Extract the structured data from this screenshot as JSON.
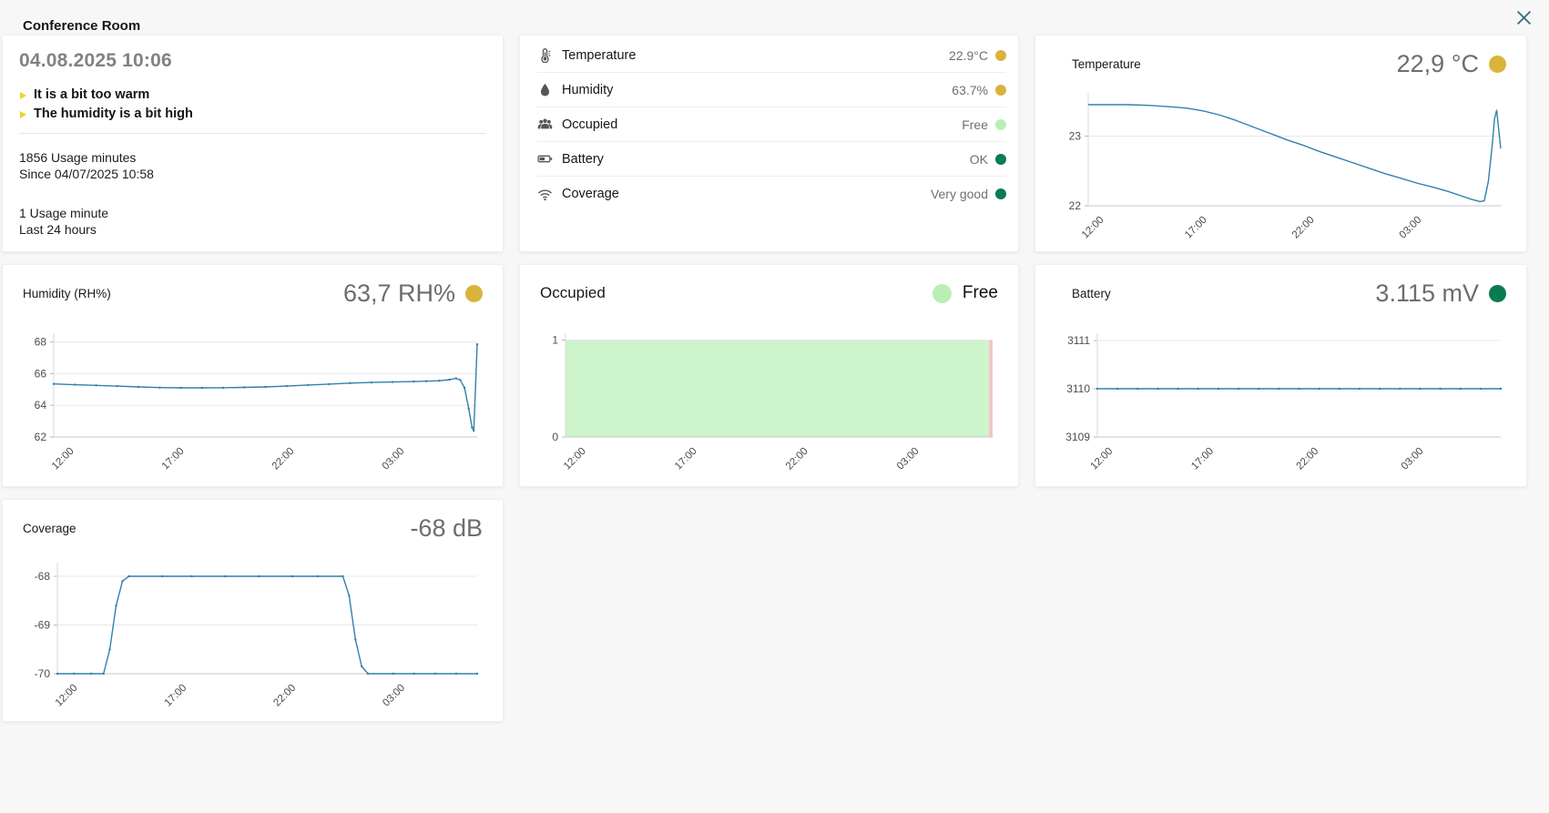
{
  "page": {
    "title": "Conference Room",
    "close_icon": "x"
  },
  "info": {
    "timestamp": "04.08.2025 10:06",
    "warnings": [
      "It is a bit too warm",
      "The humidity is a bit high"
    ],
    "usage_total_value": "1856 Usage minutes",
    "usage_total_caption": "Since 04/07/2025 10:58",
    "usage_recent_value": "1 Usage minute",
    "usage_recent_caption": "Last 24 hours"
  },
  "sensors": {
    "rows": [
      {
        "icon": "thermometer-icon",
        "label": "Temperature",
        "value": "22.9°C",
        "dot_color": "#d9b43b"
      },
      {
        "icon": "droplet-icon",
        "label": "Humidity",
        "value": "63.7%",
        "dot_color": "#d9b43b"
      },
      {
        "icon": "occupancy-icon",
        "label": "Occupied",
        "value": "Free",
        "dot_color": "#b9efb4"
      },
      {
        "icon": "battery-icon",
        "label": "Battery",
        "value": "OK",
        "dot_color": "#0b7b50"
      },
      {
        "icon": "wifi-icon",
        "label": "Coverage",
        "value": "Very good",
        "dot_color": "#0b7b50"
      }
    ]
  },
  "chart_data": [
    {
      "id": "temperature",
      "type": "line",
      "title": "Temperature",
      "value": "22,9 °C",
      "dot_color": "#d9b43b",
      "line_color": "#3380ab",
      "markers": false,
      "ymin": 22,
      "ymax": 23.62,
      "yticks": [
        22,
        23
      ],
      "xticks": [
        "12:00",
        "17:00",
        "22:00",
        "03:00"
      ],
      "xtick_frac": [
        0.03,
        0.28,
        0.54,
        0.8
      ],
      "points": [
        [
          0,
          23.45
        ],
        [
          0.05,
          23.45
        ],
        [
          0.1,
          23.45
        ],
        [
          0.15,
          23.44
        ],
        [
          0.2,
          23.42
        ],
        [
          0.24,
          23.4
        ],
        [
          0.28,
          23.36
        ],
        [
          0.32,
          23.3
        ],
        [
          0.36,
          23.22
        ],
        [
          0.4,
          23.13
        ],
        [
          0.44,
          23.04
        ],
        [
          0.48,
          22.95
        ],
        [
          0.52,
          22.87
        ],
        [
          0.56,
          22.78
        ],
        [
          0.6,
          22.7
        ],
        [
          0.64,
          22.62
        ],
        [
          0.68,
          22.54
        ],
        [
          0.72,
          22.46
        ],
        [
          0.76,
          22.39
        ],
        [
          0.8,
          22.32
        ],
        [
          0.84,
          22.26
        ],
        [
          0.87,
          22.21
        ],
        [
          0.9,
          22.15
        ],
        [
          0.93,
          22.09
        ],
        [
          0.95,
          22.06
        ],
        [
          0.96,
          22.07
        ],
        [
          0.97,
          22.35
        ],
        [
          0.98,
          22.9
        ],
        [
          0.985,
          23.25
        ],
        [
          0.99,
          23.37
        ],
        [
          1,
          22.82
        ]
      ]
    },
    {
      "id": "humidity",
      "type": "line",
      "title": "Humidity (RH%)",
      "value": "63,7 RH%",
      "dot_color": "#d9b43b",
      "line_color": "#3380ab",
      "markers": true,
      "ymin": 62,
      "ymax": 68.55,
      "yticks": [
        62,
        64,
        66,
        68
      ],
      "xticks": [
        "12:00",
        "17:00",
        "22:00",
        "03:00"
      ],
      "xtick_frac": [
        0.04,
        0.3,
        0.56,
        0.82
      ],
      "points": [
        [
          0,
          65.35
        ],
        [
          0.05,
          65.3
        ],
        [
          0.1,
          65.26
        ],
        [
          0.15,
          65.21
        ],
        [
          0.2,
          65.16
        ],
        [
          0.25,
          65.12
        ],
        [
          0.3,
          65.1
        ],
        [
          0.35,
          65.1
        ],
        [
          0.4,
          65.11
        ],
        [
          0.45,
          65.13
        ],
        [
          0.5,
          65.16
        ],
        [
          0.55,
          65.21
        ],
        [
          0.6,
          65.28
        ],
        [
          0.65,
          65.34
        ],
        [
          0.7,
          65.4
        ],
        [
          0.75,
          65.44
        ],
        [
          0.8,
          65.47
        ],
        [
          0.85,
          65.5
        ],
        [
          0.88,
          65.52
        ],
        [
          0.91,
          65.55
        ],
        [
          0.935,
          65.62
        ],
        [
          0.95,
          65.7
        ],
        [
          0.96,
          65.6
        ],
        [
          0.97,
          65.1
        ],
        [
          0.98,
          63.8
        ],
        [
          0.988,
          62.6
        ],
        [
          0.992,
          62.4
        ],
        [
          1,
          67.85
        ]
      ]
    },
    {
      "id": "occupied",
      "type": "area",
      "title": "Occupied",
      "value": "Free",
      "dot_color": "#b9efb4",
      "ymin": 0,
      "ymax": 1.07,
      "yticks": [
        0,
        1
      ],
      "xticks": [
        "12:00",
        "17:00",
        "22:00",
        "03:00"
      ],
      "xtick_frac": [
        0.04,
        0.3,
        0.56,
        0.82
      ],
      "segments": [
        {
          "from": 0,
          "to": 0.992,
          "value": 1,
          "label": "Free",
          "color": "#cdf4ca"
        },
        {
          "from": 0.992,
          "to": 1,
          "value": 1,
          "label": "Occupied",
          "color": "#f6c2c9"
        }
      ]
    },
    {
      "id": "battery",
      "type": "line",
      "title": "Battery",
      "value": "3.115 mV",
      "dot_color": "#0b7b50",
      "line_color": "#3380ab",
      "markers": true,
      "ymin": 3109,
      "ymax": 3111.15,
      "yticks": [
        3109,
        3110,
        3111
      ],
      "xticks": [
        "12:00",
        "17:00",
        "22:00",
        "03:00"
      ],
      "xtick_frac": [
        0.03,
        0.28,
        0.54,
        0.8
      ],
      "points": [
        [
          0,
          3110
        ],
        [
          0.05,
          3110
        ],
        [
          0.1,
          3110
        ],
        [
          0.15,
          3110
        ],
        [
          0.2,
          3110
        ],
        [
          0.25,
          3110
        ],
        [
          0.3,
          3110
        ],
        [
          0.35,
          3110
        ],
        [
          0.4,
          3110
        ],
        [
          0.45,
          3110
        ],
        [
          0.5,
          3110
        ],
        [
          0.55,
          3110
        ],
        [
          0.6,
          3110
        ],
        [
          0.65,
          3110
        ],
        [
          0.7,
          3110
        ],
        [
          0.75,
          3110
        ],
        [
          0.8,
          3110
        ],
        [
          0.85,
          3110
        ],
        [
          0.9,
          3110
        ],
        [
          0.95,
          3110
        ],
        [
          1,
          3110
        ]
      ]
    },
    {
      "id": "coverage",
      "type": "line",
      "title": "Coverage",
      "value": "-68 dB",
      "dot_color": null,
      "line_color": "#3380ab",
      "markers": true,
      "ymin": -70,
      "ymax": -67.72,
      "yticks": [
        -70,
        -69,
        -68
      ],
      "xticks": [
        "12:00",
        "17:00",
        "22:00",
        "03:00"
      ],
      "xtick_frac": [
        0.04,
        0.3,
        0.56,
        0.82
      ],
      "points": [
        [
          0,
          -70
        ],
        [
          0.04,
          -70
        ],
        [
          0.08,
          -70
        ],
        [
          0.11,
          -70
        ],
        [
          0.125,
          -69.5
        ],
        [
          0.14,
          -68.6
        ],
        [
          0.155,
          -68.1
        ],
        [
          0.17,
          -68
        ],
        [
          0.25,
          -68
        ],
        [
          0.32,
          -68
        ],
        [
          0.4,
          -68
        ],
        [
          0.48,
          -68
        ],
        [
          0.56,
          -68
        ],
        [
          0.62,
          -68
        ],
        [
          0.68,
          -68
        ],
        [
          0.695,
          -68.4
        ],
        [
          0.71,
          -69.3
        ],
        [
          0.725,
          -69.85
        ],
        [
          0.74,
          -70
        ],
        [
          0.8,
          -70
        ],
        [
          0.85,
          -70
        ],
        [
          0.9,
          -70
        ],
        [
          0.95,
          -70
        ],
        [
          1,
          -70
        ]
      ]
    }
  ]
}
